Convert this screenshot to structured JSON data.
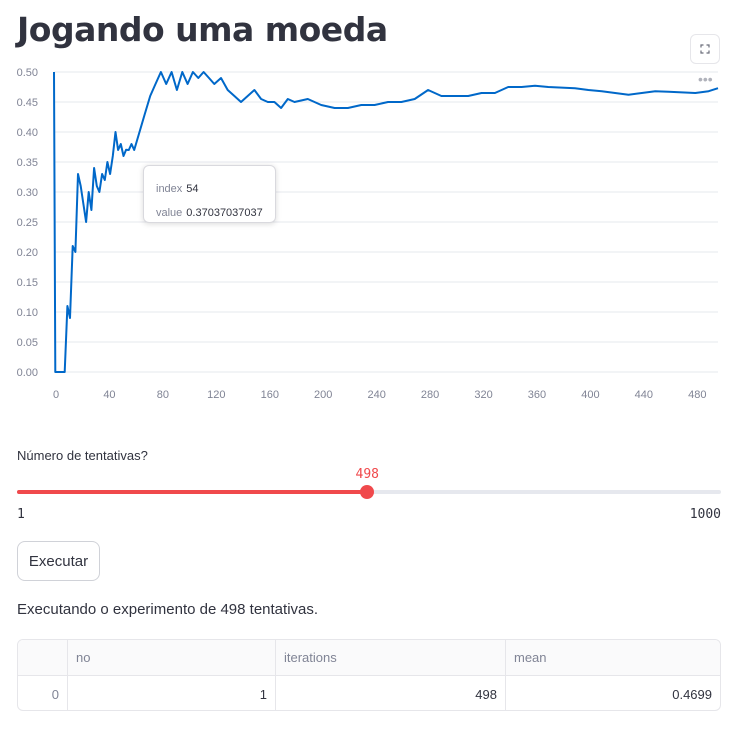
{
  "page": {
    "title": "Jogando uma moeda"
  },
  "toolbar": {
    "fullscreen_icon": "fullscreen-icon",
    "more_icon": "more-horizontal-icon"
  },
  "chart_data": {
    "type": "line",
    "title": "",
    "xlabel": "",
    "ylabel": "",
    "xlim": [
      0,
      497
    ],
    "ylim": [
      0,
      0.5
    ],
    "grid": true,
    "color": "#0068c9",
    "x_ticks": [
      "0",
      "40",
      "80",
      "120",
      "160",
      "200",
      "240",
      "280",
      "320",
      "360",
      "400",
      "440",
      "480"
    ],
    "y_ticks": [
      "0.00",
      "0.05",
      "0.10",
      "0.15",
      "0.20",
      "0.25",
      "0.30",
      "0.35",
      "0.40",
      "0.45",
      "0.50"
    ],
    "series": [
      {
        "x": [
          0,
          1,
          2,
          4,
          6,
          8,
          10,
          12,
          14,
          16,
          18,
          20,
          22,
          24,
          26,
          28,
          30,
          32,
          34,
          36,
          38,
          40,
          42,
          44,
          46,
          48,
          50,
          52,
          54,
          56,
          58,
          60,
          64,
          68,
          72,
          76,
          80,
          84,
          88,
          92,
          96,
          100,
          104,
          108,
          112,
          116,
          120,
          125,
          130,
          135,
          140,
          145,
          150,
          155,
          160,
          165,
          170,
          175,
          180,
          190,
          200,
          210,
          220,
          230,
          240,
          250,
          260,
          270,
          280,
          290,
          300,
          310,
          320,
          330,
          340,
          350,
          360,
          370,
          380,
          390,
          400,
          410,
          420,
          430,
          440,
          450,
          460,
          470,
          480,
          490,
          497
        ],
        "values": [
          0.5,
          0.0,
          0.0,
          0.0,
          0.0,
          0.0,
          0.11,
          0.09,
          0.21,
          0.2,
          0.33,
          0.31,
          0.28,
          0.25,
          0.3,
          0.27,
          0.34,
          0.31,
          0.3,
          0.33,
          0.32,
          0.35,
          0.33,
          0.36,
          0.4,
          0.37,
          0.38,
          0.36,
          0.37037037037,
          0.37,
          0.38,
          0.37,
          0.4,
          0.43,
          0.46,
          0.48,
          0.5,
          0.48,
          0.5,
          0.47,
          0.5,
          0.48,
          0.5,
          0.49,
          0.5,
          0.49,
          0.48,
          0.49,
          0.47,
          0.46,
          0.45,
          0.46,
          0.47,
          0.455,
          0.45,
          0.45,
          0.44,
          0.455,
          0.45,
          0.455,
          0.445,
          0.44,
          0.44,
          0.445,
          0.445,
          0.45,
          0.45,
          0.455,
          0.47,
          0.46,
          0.46,
          0.46,
          0.465,
          0.465,
          0.475,
          0.475,
          0.477,
          0.475,
          0.474,
          0.473,
          0.47,
          0.468,
          0.465,
          0.462,
          0.465,
          0.468,
          0.467,
          0.466,
          0.465,
          0.468,
          0.473
        ]
      }
    ]
  },
  "tooltip": {
    "index_label": "index",
    "index_value": "54",
    "value_label": "value",
    "value_value": "0.37037037037"
  },
  "slider": {
    "label": "Número de tentativas?",
    "value": "498",
    "min": "1",
    "max": "1000",
    "fraction": 0.4975,
    "color": "#f0494c"
  },
  "run_button": {
    "label": "Executar"
  },
  "status": {
    "text": "Executando o experimento de 498 tentativas."
  },
  "table": {
    "columns": [
      "",
      "no",
      "iterations",
      "mean"
    ],
    "rows": [
      {
        "index": "0",
        "no": "1",
        "iterations": "498",
        "mean": "0.4699"
      }
    ]
  }
}
